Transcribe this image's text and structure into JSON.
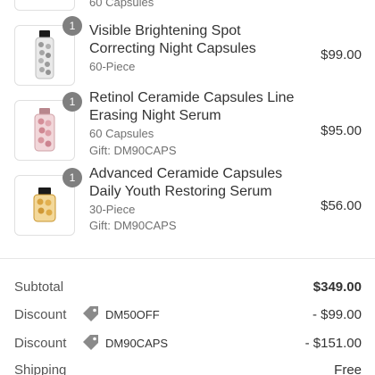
{
  "items": [
    {
      "qty": "",
      "title_lines": [
        "",
        ""
      ],
      "meta": [
        "60 Capsules"
      ],
      "price": ""
    },
    {
      "qty": "1",
      "title_lines": [
        "Visible Brightening Spot",
        "Correcting Night Capsules"
      ],
      "meta": [
        "60-Piece"
      ],
      "price": "$99.00",
      "product_color": "#c9c9c9"
    },
    {
      "qty": "1",
      "title_lines": [
        "Retinol Ceramide Capsules Line",
        "Erasing Night Serum"
      ],
      "meta": [
        "60 Capsules",
        "Gift: DM90CAPS"
      ],
      "price": "$95.00",
      "product_color": "#d8a2a8"
    },
    {
      "qty": "1",
      "title_lines": [
        "Advanced Ceramide Capsules",
        "Daily Youth Restoring Serum"
      ],
      "meta": [
        "30-Piece",
        "Gift: DM90CAPS"
      ],
      "price": "$56.00",
      "product_color": "#d9a441"
    }
  ],
  "summary": {
    "subtotal": {
      "label": "Subtotal",
      "value": "$349.00"
    },
    "discounts": [
      {
        "label": "Discount",
        "code": "DM50OFF",
        "value": "- $99.00",
        "icon": "tag-icon"
      },
      {
        "label": "Discount",
        "code": "DM90CAPS",
        "value": "- $151.00",
        "icon": "tag-icon"
      }
    ],
    "shipping": {
      "label": "Shipping",
      "value": "Free"
    }
  }
}
